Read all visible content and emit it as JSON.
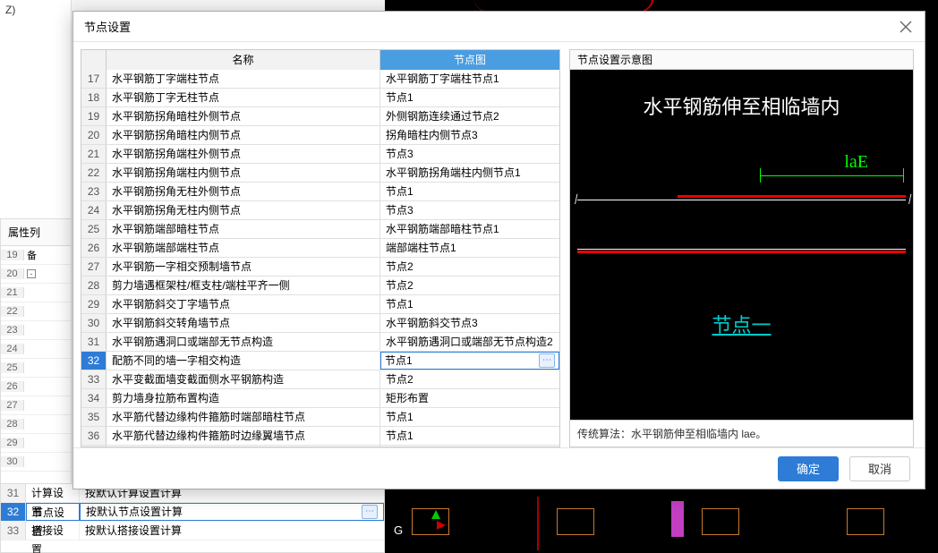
{
  "sidebar": {
    "z_label": "Z)"
  },
  "property_panel": {
    "header": "属性列",
    "rows": [
      {
        "n": "19",
        "t": "备"
      },
      {
        "n": "20",
        "t": "",
        "tree": "-"
      },
      {
        "n": "21",
        "t": ""
      },
      {
        "n": "22",
        "t": ""
      },
      {
        "n": "23",
        "t": ""
      },
      {
        "n": "24",
        "t": ""
      },
      {
        "n": "25",
        "t": ""
      },
      {
        "n": "26",
        "t": ""
      },
      {
        "n": "27",
        "t": ""
      },
      {
        "n": "28",
        "t": ""
      },
      {
        "n": "29",
        "t": ""
      },
      {
        "n": "30",
        "t": ""
      }
    ]
  },
  "bottom_grid": {
    "rows": [
      {
        "n": "31",
        "c1": "计算设置",
        "c2": "按默认计算设置计算",
        "sel": false
      },
      {
        "n": "32",
        "c1": "节点设置",
        "c2": "按默认节点设置计算",
        "sel": true,
        "with_dots": true
      },
      {
        "n": "33",
        "c1": "搭接设置",
        "c2": "按默认搭接设置计算",
        "sel": false
      }
    ]
  },
  "canvas": {
    "g_label": "G"
  },
  "dialog": {
    "title": "节点设置",
    "columns": {
      "name": "名称",
      "image": "节点图"
    },
    "rows": [
      {
        "n": 17,
        "name": "水平钢筋丁字端柱节点",
        "img": "水平钢筋丁字端柱节点1"
      },
      {
        "n": 18,
        "name": "水平钢筋丁字无柱节点",
        "img": "节点1"
      },
      {
        "n": 19,
        "name": "水平钢筋拐角暗柱外侧节点",
        "img": "外侧钢筋连续通过节点2"
      },
      {
        "n": 20,
        "name": "水平钢筋拐角暗柱内侧节点",
        "img": "拐角暗柱内侧节点3"
      },
      {
        "n": 21,
        "name": "水平钢筋拐角端柱外侧节点",
        "img": "节点3"
      },
      {
        "n": 22,
        "name": "水平钢筋拐角端柱内侧节点",
        "img": "水平钢筋拐角端柱内侧节点1"
      },
      {
        "n": 23,
        "name": "水平钢筋拐角无柱外侧节点",
        "img": "节点1"
      },
      {
        "n": 24,
        "name": "水平钢筋拐角无柱内侧节点",
        "img": "节点3"
      },
      {
        "n": 25,
        "name": "水平钢筋端部暗柱节点",
        "img": "水平钢筋端部暗柱节点1"
      },
      {
        "n": 26,
        "name": "水平钢筋端部端柱节点",
        "img": "端部端柱节点1"
      },
      {
        "n": 27,
        "name": "水平钢筋一字相交预制墙节点",
        "img": "节点2"
      },
      {
        "n": 28,
        "name": "剪力墙遇框架柱/框支柱/端柱平齐一侧",
        "img": "节点2"
      },
      {
        "n": 29,
        "name": "水平钢筋斜交丁字墙节点",
        "img": "节点1"
      },
      {
        "n": 30,
        "name": "水平钢筋斜交转角墙节点",
        "img": "水平钢筋斜交节点3"
      },
      {
        "n": 31,
        "name": "水平钢筋遇洞口或端部无节点构造",
        "img": "水平钢筋遇洞口或端部无节点构造2"
      },
      {
        "n": 32,
        "name": "配筋不同的墙一字相交构造",
        "img": "节点1",
        "selected": true,
        "with_dots": true
      },
      {
        "n": 33,
        "name": "水平变截面墙变截面侧水平钢筋构造",
        "img": "节点2"
      },
      {
        "n": 34,
        "name": "剪力墙身拉筋布置构造",
        "img": "矩形布置"
      },
      {
        "n": 35,
        "name": "水平筋代替边缘构件箍筋时端部暗柱节点",
        "img": "节点1"
      },
      {
        "n": 36,
        "name": "水平筋代替边缘构件箍筋时边缘翼墙节点",
        "img": "节点1"
      },
      {
        "n": 37,
        "name": "",
        "img": ""
      }
    ],
    "preview": {
      "header": "节点设置示意图",
      "title_text": "水平钢筋伸至相临墙内",
      "dim_label": "laE",
      "node_label": "节点一",
      "footer": "传统算法：水平钢筋伸至相临墙内 lae。"
    },
    "buttons": {
      "ok": "确定",
      "cancel": "取消"
    }
  }
}
